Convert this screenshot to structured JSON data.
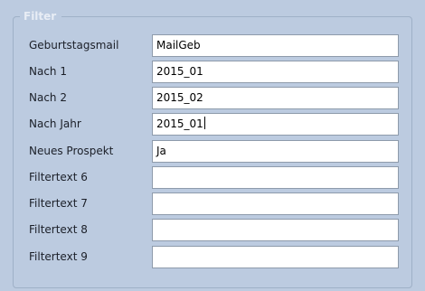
{
  "filter_group": {
    "title": "Filter",
    "fields": [
      {
        "label": "Geburtstagsmail",
        "value": "MailGeb"
      },
      {
        "label": "Nach 1",
        "value": "2015_01"
      },
      {
        "label": "Nach 2",
        "value": "2015_02"
      },
      {
        "label": "Nach Jahr",
        "value": "2015_01"
      },
      {
        "label": "Neues Prospekt",
        "value": "Ja"
      },
      {
        "label": "Filtertext 6",
        "value": ""
      },
      {
        "label": "Filtertext 7",
        "value": ""
      },
      {
        "label": "Filtertext 8",
        "value": ""
      },
      {
        "label": "Filtertext 9",
        "value": ""
      }
    ]
  },
  "colors": {
    "panel_background": "#bccbe0",
    "frame_border": "#9fb1c7",
    "legend_text": "#e8edf5",
    "input_border": "#8e9bab"
  }
}
